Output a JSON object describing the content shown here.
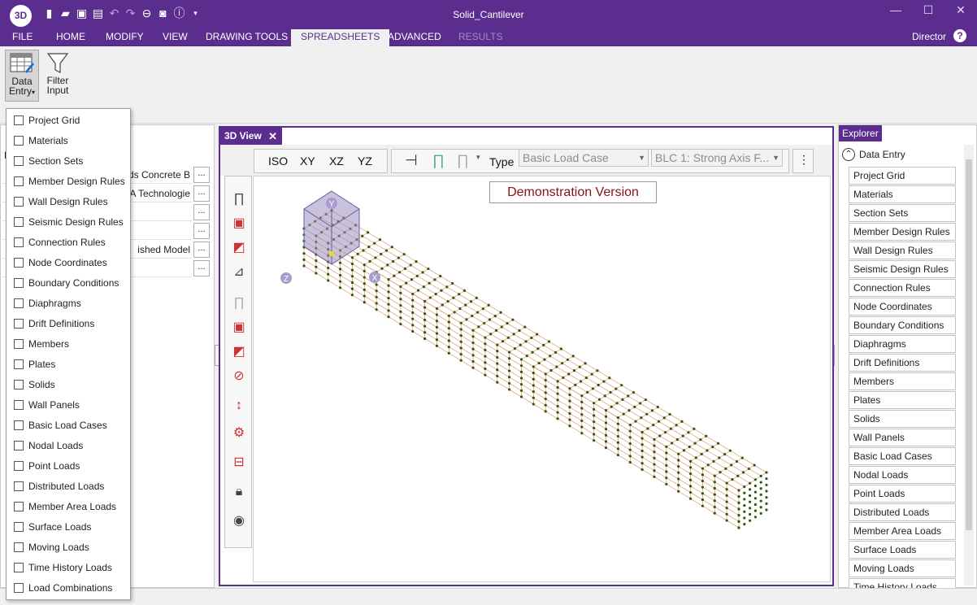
{
  "app": {
    "logo": "3D",
    "window_title": "Solid_Cantilever",
    "user": "Director",
    "help": "?",
    "quick_access_icons": [
      "new-file-icon",
      "open-folder-icon",
      "save-icon",
      "print-icon",
      "undo-icon",
      "redo-icon",
      "minus-circle-icon",
      "camera-icon",
      "info-icon",
      "customize-icon"
    ]
  },
  "menu": {
    "file": "FILE",
    "home": "HOME",
    "modify": "MODIFY",
    "view": "VIEW",
    "drawing_tools": "DRAWING TOOLS",
    "spreadsheets": "SPREADSHEETS",
    "advanced": "ADVANCED",
    "results": "RESULTS"
  },
  "ribbon": {
    "data_entry_line1": "Data",
    "data_entry_line2": "Entry",
    "filter_line1": "Filter",
    "filter_line2": "Input"
  },
  "dropdown": {
    "items": [
      "Project Grid",
      "Materials",
      "Section Sets",
      "Member Design Rules",
      "Wall Design Rules",
      "Seismic Design Rules",
      "Connection Rules",
      "Node Coordinates",
      "Boundary Conditions",
      "Diaphragms",
      "Drift Definitions",
      "Members",
      "Plates",
      "Solids",
      "Wall Panels",
      "Basic Load Cases",
      "Nodal Loads",
      "Point Loads",
      "Distributed Loads",
      "Member Area Loads",
      "Surface Loads",
      "Moving Loads",
      "Time History Loads",
      "Load Combinations"
    ]
  },
  "left_panel": {
    "rows": [
      "ids Concrete B",
      "A Technologie",
      "",
      "",
      "ished Model",
      ""
    ],
    "button": "...",
    "partial_label": "D"
  },
  "view3d": {
    "tab_label": "3D View",
    "close": "✕",
    "views": {
      "iso": "ISO",
      "xy": "XY",
      "xz": "XZ",
      "yz": "YZ"
    },
    "type_label": "Type",
    "type_value": "Basic Load Case",
    "case_value": "BLC 1: Strong Axis F...",
    "demo_banner": "Demonstration Version",
    "axis_y": "Y",
    "axis_x": "X",
    "axis_z": "Z"
  },
  "explorer": {
    "header": "Explorer",
    "title": "Data Entry",
    "items": [
      "Project Grid",
      "Materials",
      "Section Sets",
      "Member Design Rules",
      "Wall Design Rules",
      "Seismic Design Rules",
      "Connection Rules",
      "Node Coordinates",
      "Boundary Conditions",
      "Diaphragms",
      "Drift Definitions",
      "Members",
      "Plates",
      "Solids",
      "Wall Panels",
      "Basic Load Cases",
      "Nodal Loads",
      "Point Loads",
      "Distributed Loads",
      "Member Area Loads",
      "Surface Loads",
      "Moving Loads",
      "Time History Loads"
    ]
  },
  "colors": {
    "accent": "#5b2d8f",
    "mesh_node": "#2f5a0a",
    "mesh_line": "#e08a5a",
    "demo_text": "#8b1010"
  }
}
